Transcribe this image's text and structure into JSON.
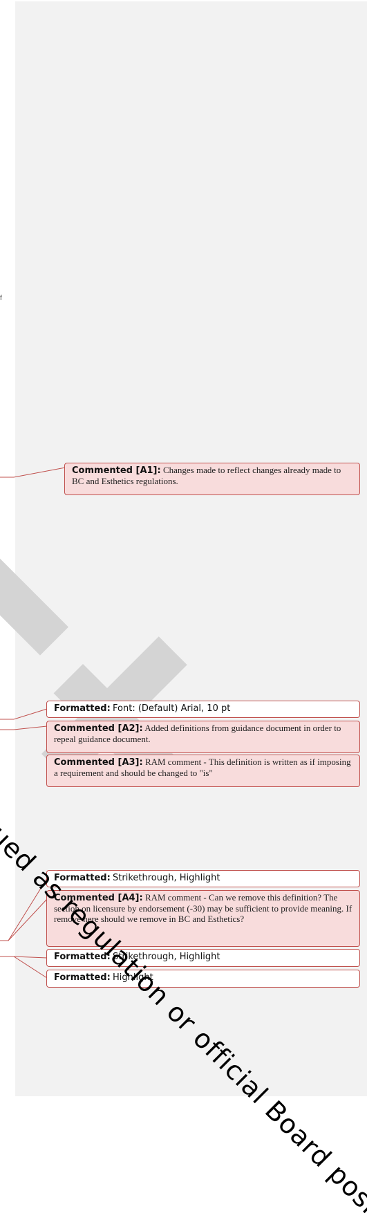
{
  "stray_char": "f",
  "balloons": [
    {
      "label": "Commented [A1]:",
      "text": "Changes made to reflect changes already made to BC and Esthetics regulations."
    },
    {
      "label": "Formatted:",
      "text": "Font: (Default) Arial, 10 pt"
    },
    {
      "label": "Commented [A2]:",
      "text": "Added definitions from guidance document in order to repeal guidance document."
    },
    {
      "label": "Commented [A3]:",
      "text": "RAM comment - This definition is written as if imposing a requirement and should be changed to \"is\""
    },
    {
      "label": "Formatted:",
      "text": "Strikethrough, Highlight"
    },
    {
      "label": "Commented [A4]:",
      "text": "RAM comment - Can we remove this definition? The section on licensure by endorsement (-30) may be sufficient to provide meaning. If remove here should we remove in BC and Esthetics?"
    },
    {
      "label": "Formatted:",
      "text": "Strikethrough, Highlight"
    },
    {
      "label": "Formatted:",
      "text": "Highlight"
    }
  ],
  "watermark": "ued as regulation or official Board posi",
  "colors": {
    "comment_fill": "#f8dcdc",
    "border": "#c0504d",
    "pane": "#f2f2f2",
    "watermark_band": "#d4d4d4"
  }
}
